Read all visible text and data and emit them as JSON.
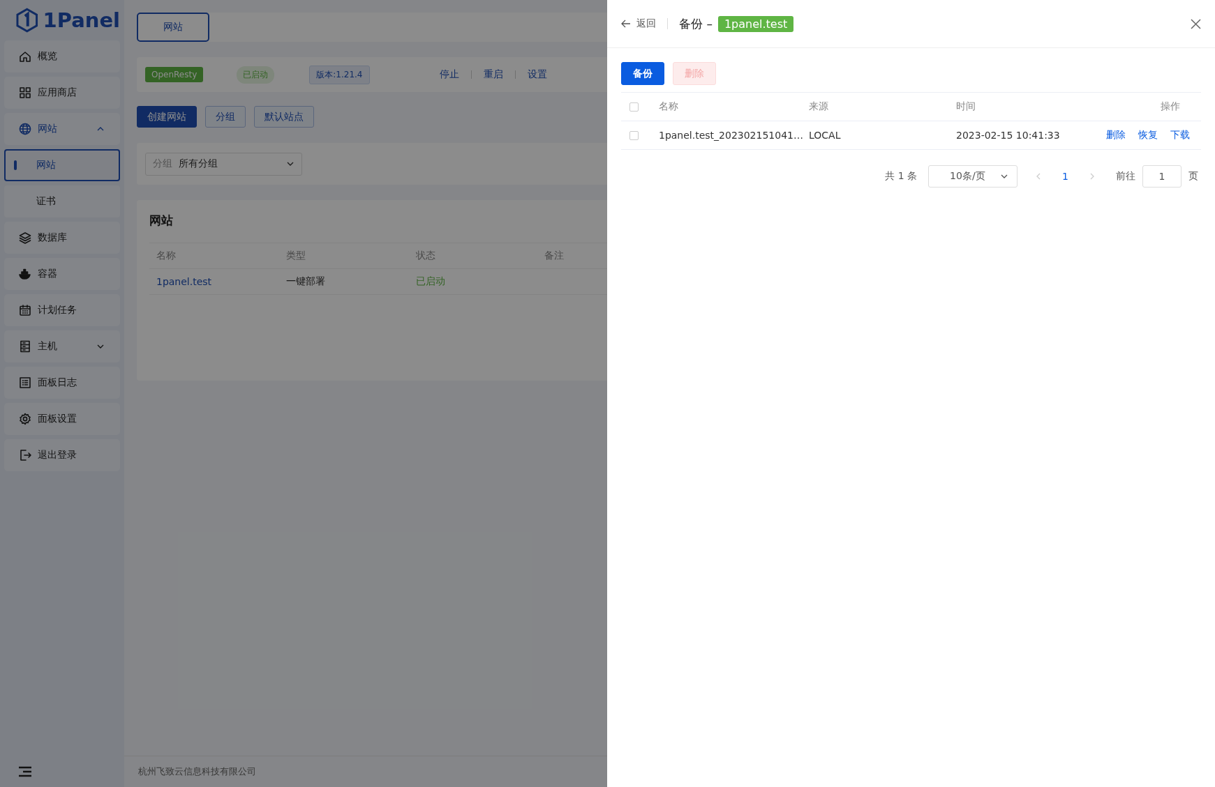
{
  "sidebar": {
    "logo": "1Panel",
    "items": [
      {
        "kind": "link",
        "label": "概览",
        "selected": false
      },
      {
        "kind": "link",
        "label": "应用商店",
        "selected": false
      },
      {
        "kind": "group",
        "label": "网站",
        "selected": true,
        "expanded": true,
        "children": [
          {
            "label": "网站",
            "selected": true
          },
          {
            "label": "证书",
            "selected": false
          }
        ]
      },
      {
        "kind": "link",
        "label": "数据库",
        "selected": false
      },
      {
        "kind": "link",
        "label": "容器",
        "selected": false
      },
      {
        "kind": "link",
        "label": "计划任务",
        "selected": false
      },
      {
        "kind": "group",
        "label": "主机",
        "selected": false,
        "expanded": false
      },
      {
        "kind": "link",
        "label": "面板日志",
        "selected": false
      },
      {
        "kind": "link",
        "label": "面板设置",
        "selected": false
      },
      {
        "kind": "link",
        "label": "退出登录",
        "selected": false
      }
    ]
  },
  "main": {
    "tabs": [
      {
        "label": "网站",
        "selected": true
      }
    ],
    "server_bar": {
      "name": "OpenResty",
      "status": "已启动",
      "version": "版本:1.21.4",
      "actions": [
        "停止",
        "重启",
        "设置"
      ]
    },
    "toolbar": [
      {
        "label": "创建网站",
        "kind": "primary"
      },
      {
        "label": "分组",
        "kind": "plain"
      },
      {
        "label": "默认站点",
        "kind": "plain"
      }
    ],
    "filter": {
      "label": "分组",
      "value": "所有分组"
    },
    "sites": {
      "title": "网站",
      "columns": [
        "名称",
        "类型",
        "状态",
        "备注"
      ],
      "rows": [
        {
          "name": "1panel.test",
          "type": "一键部署",
          "status": "已启动"
        }
      ]
    },
    "footer": "杭州飞致云信息科技有限公司"
  },
  "drawer": {
    "back": "返回",
    "title": "备份 –",
    "tag": "1panel.test",
    "buttons": [
      {
        "label": "备份",
        "kind": "primary",
        "disabled": false
      },
      {
        "label": "删除",
        "kind": "danger",
        "disabled": true
      }
    ],
    "table": {
      "all_selected": false,
      "columns": [
        "名称",
        "来源",
        "时间",
        "操作"
      ],
      "rows": [
        {
          "selected": false,
          "name": "1panel.test_202302151041…",
          "source": "LOCAL",
          "time": "2023-02-15 10:41:33",
          "actions": [
            "删除",
            "恢复",
            "下载"
          ]
        }
      ]
    },
    "pagination": {
      "total": "共 1 条",
      "page_size": "10条/页",
      "pages": [
        {
          "label": "1",
          "selected": true
        }
      ],
      "goto_label": "前往",
      "goto_value": "1",
      "goto_suffix": "页"
    }
  }
}
